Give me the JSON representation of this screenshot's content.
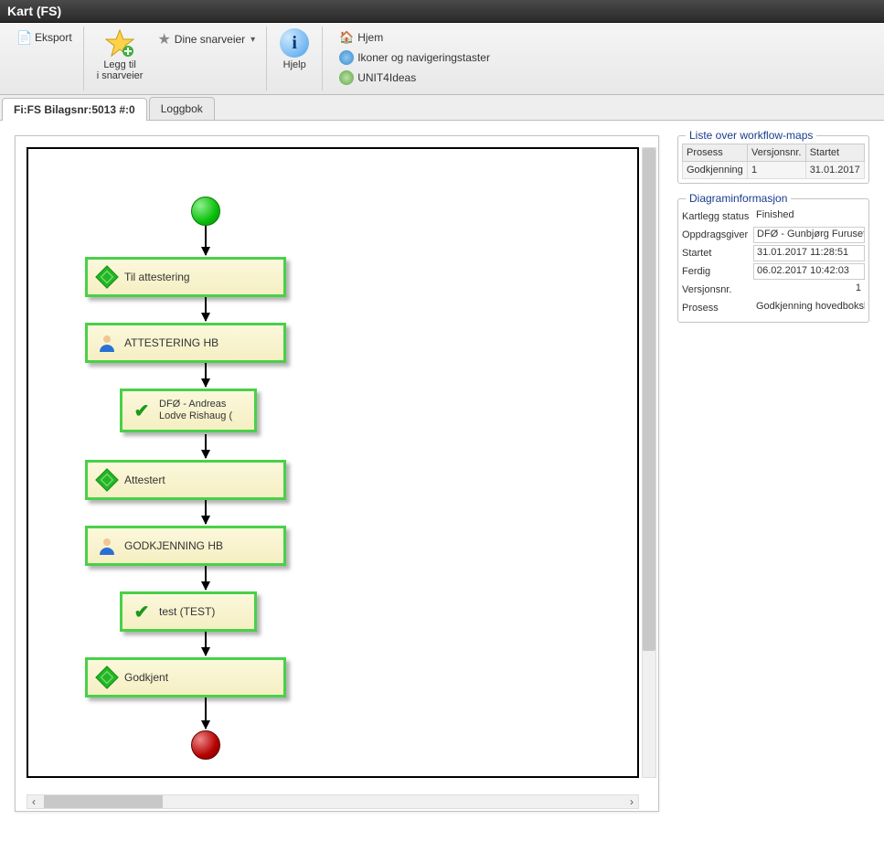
{
  "window": {
    "title": "Kart (FS)"
  },
  "toolbar": {
    "export": "Eksport",
    "add_shortcut": "Legg til\ni snarveier",
    "your_shortcuts": "Dine snarveier",
    "help": "Hjelp",
    "links": {
      "home": "Hjem",
      "icons_nav": "Ikoner og navigeringstaster",
      "unit4ideas": "UNIT4Ideas"
    }
  },
  "tabs": {
    "main": "Fi:FS Bilagsnr:5013 #:0",
    "log": "Loggbok"
  },
  "flow": {
    "nodes": [
      {
        "label": "Til attestering",
        "icon": "diamond"
      },
      {
        "label": "ATTESTERING HB",
        "icon": "person"
      },
      {
        "label": "DFØ - Andreas Lodve Rishaug (",
        "icon": "check",
        "small": true
      },
      {
        "label": "Attestert",
        "icon": "diamond"
      },
      {
        "label": "GODKJENNING HB",
        "icon": "person"
      },
      {
        "label": "test (TEST)",
        "icon": "check",
        "small": true
      },
      {
        "label": "Godkjent",
        "icon": "diamond"
      }
    ]
  },
  "workflow_maps": {
    "legend": "Liste over workflow-maps",
    "headers": {
      "prosess": "Prosess",
      "versjon": "Versjonsnr.",
      "startet": "Startet"
    },
    "rows": [
      {
        "prosess": "Godkjenning",
        "versjon": "1",
        "startet": "31.01.2017"
      }
    ]
  },
  "diagram_info": {
    "legend": "Diagraminformasjon",
    "fields": {
      "status_k": "Kartlegg status",
      "status_v": "Finished",
      "oppdrag_k": "Oppdragsgiver",
      "oppdrag_v": "DFØ - Gunbjørg Furuseth",
      "startet_k": "Startet",
      "startet_v": "31.01.2017 11:28:51",
      "ferdig_k": "Ferdig",
      "ferdig_v": "06.02.2017 10:42:03",
      "versjon_k": "Versjonsnr.",
      "versjon_v": "1",
      "prosess_k": "Prosess",
      "prosess_v": "Godkjenning hovedboksbi"
    }
  }
}
